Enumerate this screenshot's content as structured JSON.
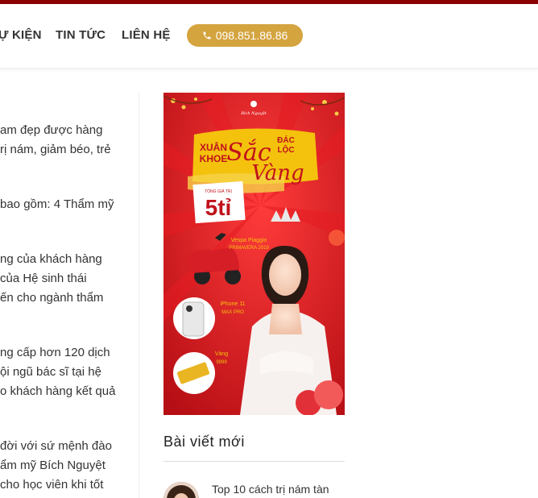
{
  "header": {
    "nav": [
      "Ự KIỆN",
      "TIN TỨC",
      "LIÊN HỆ"
    ],
    "phone": "098.851.86.86"
  },
  "content": {
    "lines": [
      "am đẹp được hàng",
      "rị nám, giảm béo, trẻ",
      "bao gồm: 4 Thẩm mỹ",
      "ng của khách hàng",
      "của Hệ sinh thái",
      "ến cho ngành thẩm",
      "ng cấp hơn 120 dịch",
      "ội ngũ bác sĩ tại hệ",
      "o khách hàng kết quả",
      "đời với sứ mệnh đào",
      "ẩm mỹ Bích Nguyệt",
      "cho học viên khi tốt"
    ]
  },
  "banner": {
    "brand": "Bích Nguyệt",
    "headline_left_1": "XUÂN",
    "headline_left_2": "KHOE",
    "headline_script": "Sắc",
    "headline_right_1": "ĐÁC",
    "headline_right_2": "LỘC",
    "headline_script_2": "Vàng",
    "prize_label": "TỔNG GIÁ TRỊ",
    "prize_value": "5tỉ",
    "prize1_line1": "Vespa Piaggio",
    "prize1_line2": "PRIMAVERA 2019",
    "prize2_line1": "iPhone 11",
    "prize2_line2": "MAX PRO",
    "prize3_line1": "Vàng",
    "prize3_line2": "9999",
    "colors": {
      "red": "#d0121b",
      "gold": "#f4c20d"
    }
  },
  "sidebar": {
    "title": "Bài viết mới",
    "posts": [
      {
        "title": "Top 10 cách trị nám tàn"
      }
    ]
  }
}
